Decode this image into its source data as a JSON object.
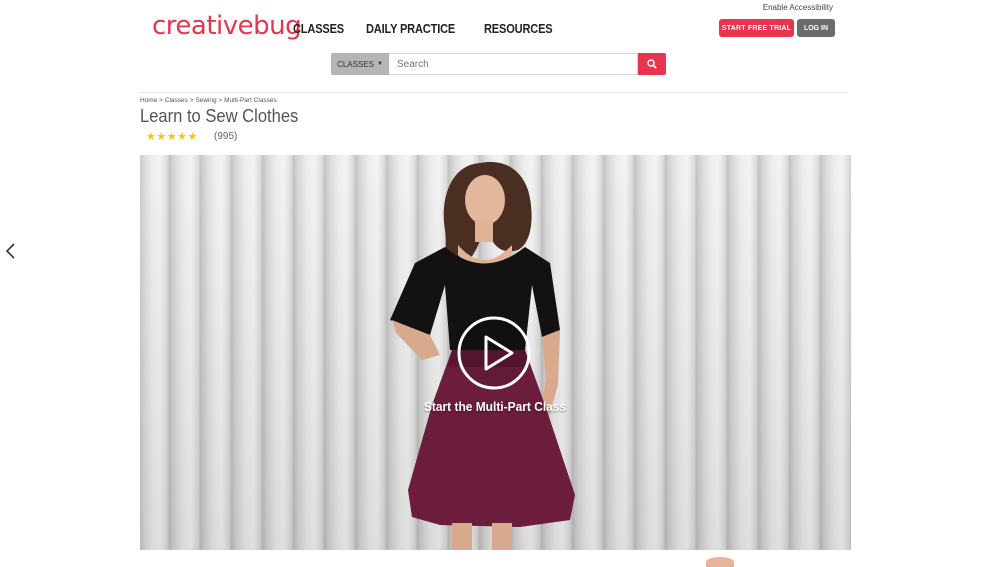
{
  "header": {
    "accessibility_link": "Enable Accessibility",
    "logo_text": "creativebug",
    "nav": [
      {
        "label": "CLASSES"
      },
      {
        "label": "DAILY PRACTICE"
      },
      {
        "label": "RESOURCES"
      }
    ],
    "start_trial_label": "START FREE TRIAL",
    "login_label": "LOG IN",
    "brand_color": "#e8344d"
  },
  "search": {
    "category_label": "CLASSES",
    "placeholder": "Search",
    "value": ""
  },
  "breadcrumb": [
    "Home",
    "Classes",
    "Sewing",
    "Multi-Part Classes"
  ],
  "class_info": {
    "title": "Learn to Sew Clothes",
    "rating_stars": "★★★★★",
    "rating_value": 5,
    "rating_count": "(995)"
  },
  "hero": {
    "caption": "Start the Multi-Part Class",
    "play_icon": "play-circle-icon"
  },
  "carousel": {
    "prev_icon": "chevron-left-icon"
  }
}
